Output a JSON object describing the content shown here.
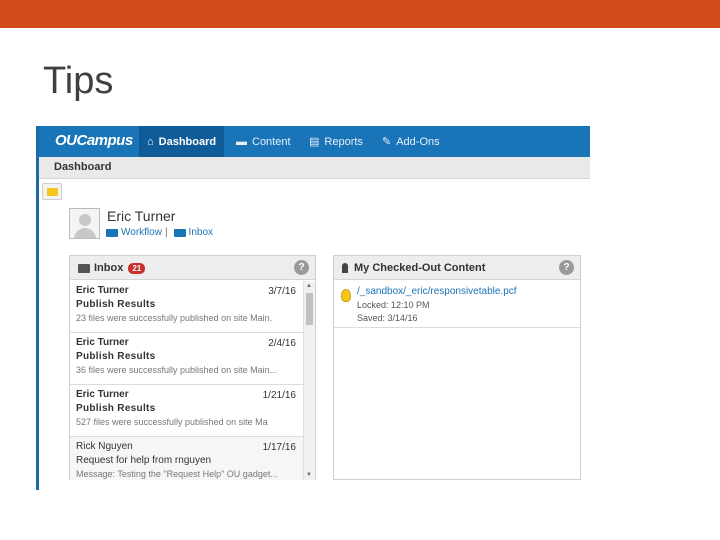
{
  "slide": {
    "title": "Tips",
    "accent_color": "#d24b1a"
  },
  "nav": {
    "logo": "OUCampus",
    "items": [
      {
        "label": "Dashboard",
        "icon": "home-icon",
        "active": true
      },
      {
        "label": "Content",
        "icon": "folder-icon",
        "active": false
      },
      {
        "label": "Reports",
        "icon": "clipboard-icon",
        "active": false
      },
      {
        "label": "Add-Ons",
        "icon": "plug-icon",
        "active": false
      }
    ],
    "color": "#1a74b8"
  },
  "breadcrumb": "Dashboard",
  "user": {
    "name": "Eric Turner",
    "workflow_label": "Workflow",
    "separator": "|",
    "inbox_label": "Inbox"
  },
  "inbox": {
    "title": "Inbox",
    "count": "21",
    "help": "?",
    "messages": [
      {
        "from": "Eric Turner",
        "date": "3/7/16",
        "subject": "Publish Results",
        "preview": "23 files were successfully published on site Main."
      },
      {
        "from": "Eric Turner",
        "date": "2/4/16",
        "subject": "Publish Results",
        "preview": "36 files were successfully published on site Main..."
      },
      {
        "from": "Eric Turner",
        "date": "1/21/16",
        "subject": "Publish Results",
        "preview": "527 files were successfully published on site Ma"
      },
      {
        "from": "Rick Nguyen",
        "date": "1/17/16",
        "subject": "Request for help from rnguyen",
        "preview": "Message: Testing the \"Request Help\" OU gadget..."
      }
    ]
  },
  "checked_out": {
    "title": "My Checked-Out Content",
    "help": "?",
    "items": [
      {
        "path": "/_sandbox/_eric/responsivetable.pcf",
        "locked": "Locked: 12:10 PM",
        "saved": "Saved: 3/14/16"
      }
    ]
  }
}
